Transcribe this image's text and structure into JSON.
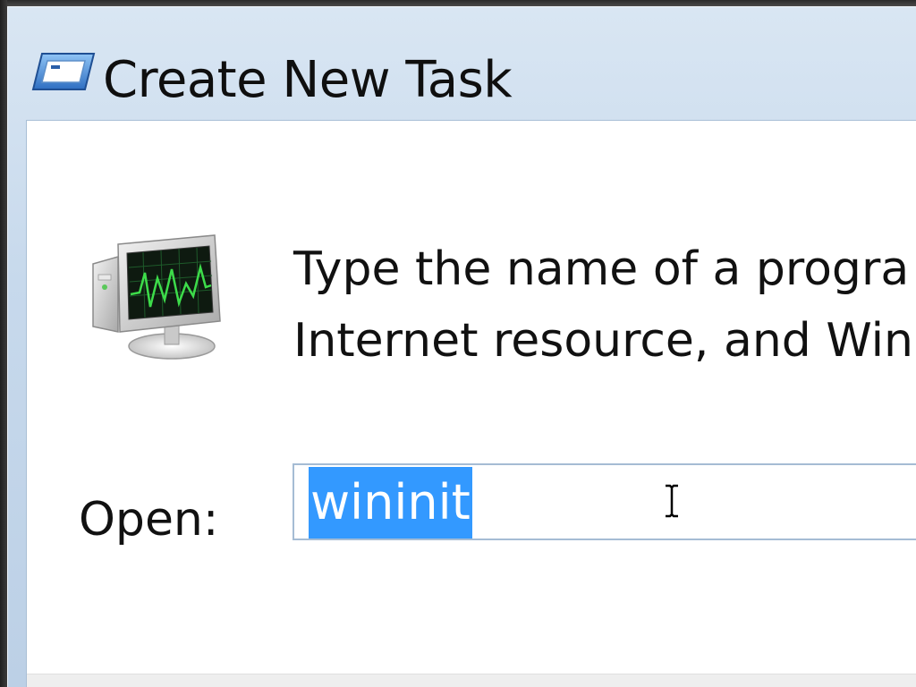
{
  "window": {
    "title": "Create New Task",
    "title_icon": "run-dialog-icon"
  },
  "dialog": {
    "app_icon": "task-manager-monitor-icon",
    "message_line1": "Type the name of a progra",
    "message_line2": "Internet resource, and Win",
    "open_label": "Open:",
    "open_value": "wininit",
    "open_value_selected": true,
    "cursor": "text-ibeam-cursor"
  },
  "colors": {
    "selection": "#3399ff",
    "frame": "#c7d9ec",
    "input_border": "#a5bcd4"
  }
}
